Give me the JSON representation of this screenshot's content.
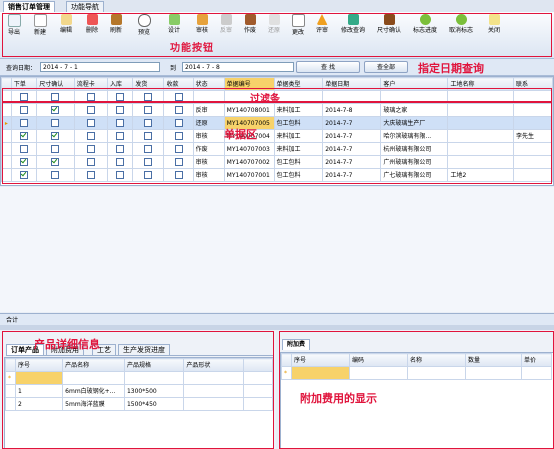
{
  "tabs": [
    "销售订单管理",
    "功能导航"
  ],
  "toolbar": {
    "buttons": [
      "导出",
      "新建",
      "编辑",
      "删除",
      "刷新",
      "预览",
      "设计",
      "审核",
      "反审",
      "作废",
      "还原",
      "更改",
      "评审",
      "修改查询",
      "尺寸确认",
      "标志进度",
      "取消标志",
      "关闭"
    ],
    "caption": "功能按钮"
  },
  "query": {
    "label": "查询日期：",
    "from": "2014 - 7 - 1",
    "to_label": "到",
    "to": "2014 - 7 - 8",
    "find": "查 找",
    "all": "查全部",
    "caption": "指定日期查询"
  },
  "grid": {
    "columns": [
      "下单",
      "尺寸确认",
      "流程卡",
      "入库",
      "发货",
      "收款",
      "状态",
      "单据编号",
      "单据类型",
      "单据日期",
      "客户",
      "工地名称",
      "联系"
    ],
    "filter_caption": "过滤条",
    "area_caption": "单据区",
    "rows": [
      {
        "down": false,
        "size": true,
        "status": "反审",
        "code": "MY140708001",
        "type": "来料加工",
        "date": "2014-7-8",
        "customer": "玻璃之家",
        "site": "",
        "contact": ""
      },
      {
        "down": false,
        "size": false,
        "status": "还原",
        "code": "MY140707005",
        "type": "包工包料",
        "date": "2014-7-7",
        "customer": "大庆玻璃生产厂",
        "site": "",
        "contact": ""
      },
      {
        "down": true,
        "size": true,
        "status": "审核",
        "code": "MY140707004",
        "type": "来料加工",
        "date": "2014-7-7",
        "customer": "哈尔滨玻璃有限...",
        "site": "",
        "contact": "李先生"
      },
      {
        "down": false,
        "size": false,
        "status": "作废",
        "code": "MY140707003",
        "type": "来料加工",
        "date": "2014-7-7",
        "customer": "杭州玻璃有限公司",
        "site": "",
        "contact": ""
      },
      {
        "down": true,
        "size": true,
        "status": "审核",
        "code": "MY140707002",
        "type": "包工包料",
        "date": "2014-7-7",
        "customer": "广州玻璃有限公司",
        "site": "",
        "contact": ""
      },
      {
        "down": true,
        "size": false,
        "status": "审核",
        "code": "MY140707001",
        "type": "包工包料",
        "date": "2014-7-7",
        "customer": "广七玻璃有限公司",
        "site": "工地2",
        "contact": ""
      }
    ]
  },
  "sumbar": {
    "label": "合计"
  },
  "left_panel": {
    "tabs": [
      "订单产品",
      "附加费用",
      "工艺",
      "生产发货进度"
    ],
    "caption": "产品详细信息",
    "columns": [
      "序号",
      "产品名称",
      "产品规格",
      "产品形状"
    ],
    "rows": [
      {
        "no": "1",
        "name": "6mm白玻钢化+...",
        "spec": "1300*500",
        "shape": ""
      },
      {
        "no": "2",
        "name": "5mm海洋蓝膜",
        "spec": "1500*450",
        "shape": ""
      }
    ]
  },
  "right_panel": {
    "tab": "附加费",
    "caption": "附加费用的显示",
    "columns": [
      "序号",
      "编码",
      "名称",
      "数量",
      "单价"
    ]
  }
}
